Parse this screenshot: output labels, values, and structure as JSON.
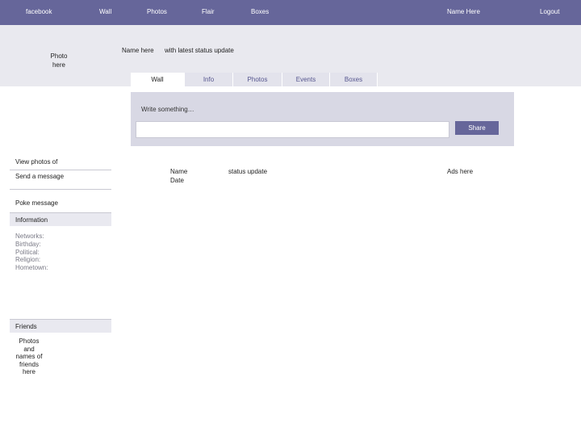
{
  "nav": {
    "logo": "facebook",
    "items": [
      "Wall",
      "Photos",
      "Flair",
      "Boxes"
    ],
    "user_name": "Name Here",
    "logout": "Logout"
  },
  "profile": {
    "photo_placeholder_line1": "Photo",
    "photo_placeholder_line2": "here",
    "name": "Name here",
    "status": "with latest status update"
  },
  "tabs": [
    {
      "label": "Wall",
      "active": true
    },
    {
      "label": "Info",
      "active": false
    },
    {
      "label": "Photos",
      "active": false
    },
    {
      "label": "Events",
      "active": false
    },
    {
      "label": "Boxes",
      "active": false
    }
  ],
  "composer": {
    "prompt": "Write something…",
    "input_value": "",
    "share_label": "Share"
  },
  "sidebar": {
    "view_photos": "View photos of",
    "send_message": "Send a message",
    "poke": "Poke message",
    "information_header": "Information",
    "info_fields": [
      "Networks:",
      "Birthday:",
      "Political:",
      "Religion:",
      "Hometown:"
    ],
    "friends_header": "Friends",
    "friends_placeholder": [
      "Photos",
      "and",
      "names of",
      "friends",
      "here"
    ]
  },
  "feed": {
    "post_name": "Name",
    "post_date": "Date",
    "post_status": "status update"
  },
  "ads": {
    "label": "Ads here"
  },
  "colors": {
    "topbar": "#66669a",
    "band": "#e9e9ef",
    "composer": "#d8d8e4",
    "accent": "#55558e"
  }
}
